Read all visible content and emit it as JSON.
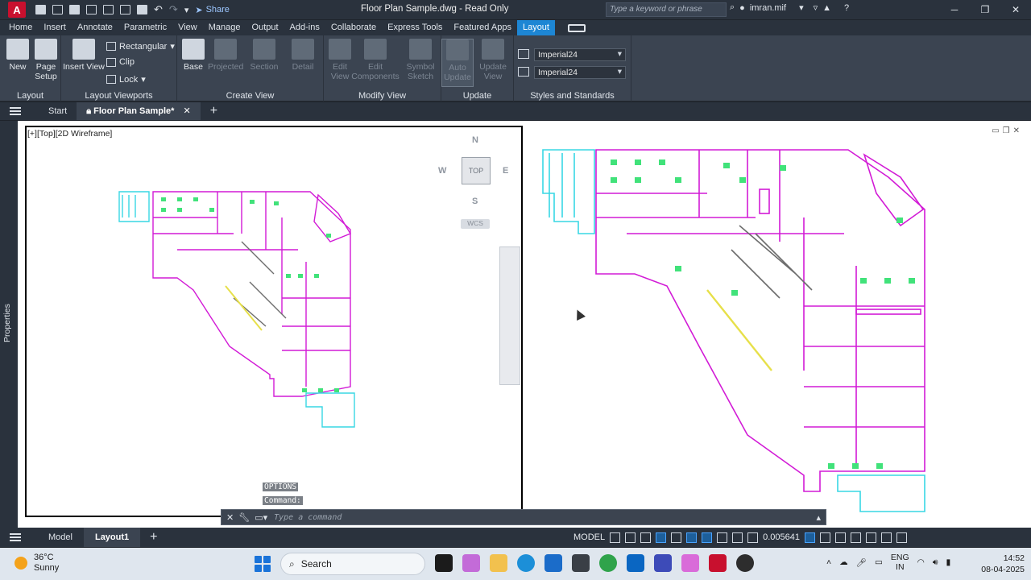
{
  "app": {
    "logo_letter": "A",
    "share_label": "Share",
    "document_title": "Floor Plan Sample.dwg - Read Only",
    "search_placeholder": "Type a keyword or phrase",
    "user": "imran.mif"
  },
  "ribbon_tabs": [
    "Home",
    "Insert",
    "Annotate",
    "Parametric",
    "View",
    "Manage",
    "Output",
    "Add-ins",
    "Collaborate",
    "Express Tools",
    "Featured Apps",
    "Layout"
  ],
  "active_ribbon_tab": "Layout",
  "ribbon": {
    "layout_panel": {
      "title": "Layout",
      "new": "New",
      "page_setup_1": "Page",
      "page_setup_2": "Setup"
    },
    "viewports_panel": {
      "title": "Layout Viewports",
      "insert_view_1": "Insert View",
      "rectangular": "Rectangular",
      "clip": "Clip",
      "lock": "Lock"
    },
    "create_view_panel": {
      "title": "Create View",
      "base": "Base",
      "projected": "Projected",
      "section": "Section",
      "detail": "Detail"
    },
    "modify_view_panel": {
      "title": "Modify View",
      "edit_view_1": "Edit",
      "edit_view_2": "View",
      "edit_components_1": "Edit",
      "edit_components_2": "Components",
      "symbol_sketch_1": "Symbol",
      "symbol_sketch_2": "Sketch"
    },
    "update_panel": {
      "title": "Update",
      "auto_update_1": "Auto",
      "auto_update_2": "Update",
      "update_view_1": "Update",
      "update_view_2": "View"
    },
    "styles_panel": {
      "title": "Styles and Standards",
      "style1": "Imperial24",
      "style2": "Imperial24"
    }
  },
  "file_tabs": {
    "start": "Start",
    "active": "Floor Plan Sample*"
  },
  "viewport": {
    "label": "[+][Top][2D Wireframe]",
    "viewcube": {
      "top": "TOP",
      "n": "N",
      "s": "S",
      "e": "E",
      "w": "W",
      "wcs": "WCS"
    }
  },
  "properties_label": "Properties",
  "command": {
    "hist1": "OPTIONS",
    "hist2": "Command:",
    "placeholder": "Type a command"
  },
  "layout_tabs": {
    "model": "Model",
    "layout1": "Layout1"
  },
  "status": {
    "model": "MODEL",
    "scale": "0.005641"
  },
  "taskbar": {
    "temp": "36°C",
    "weather": "Sunny",
    "search": "Search",
    "lang1": "ENG",
    "lang2": "IN",
    "time": "14:52",
    "date": "08-04-2025"
  },
  "colors": {
    "accent": "#1d86d4",
    "plan_magenta": "#d21bd6",
    "plan_cyan": "#38d7e4",
    "plan_green": "#41e27a",
    "plan_yellow": "#e7e04a"
  }
}
